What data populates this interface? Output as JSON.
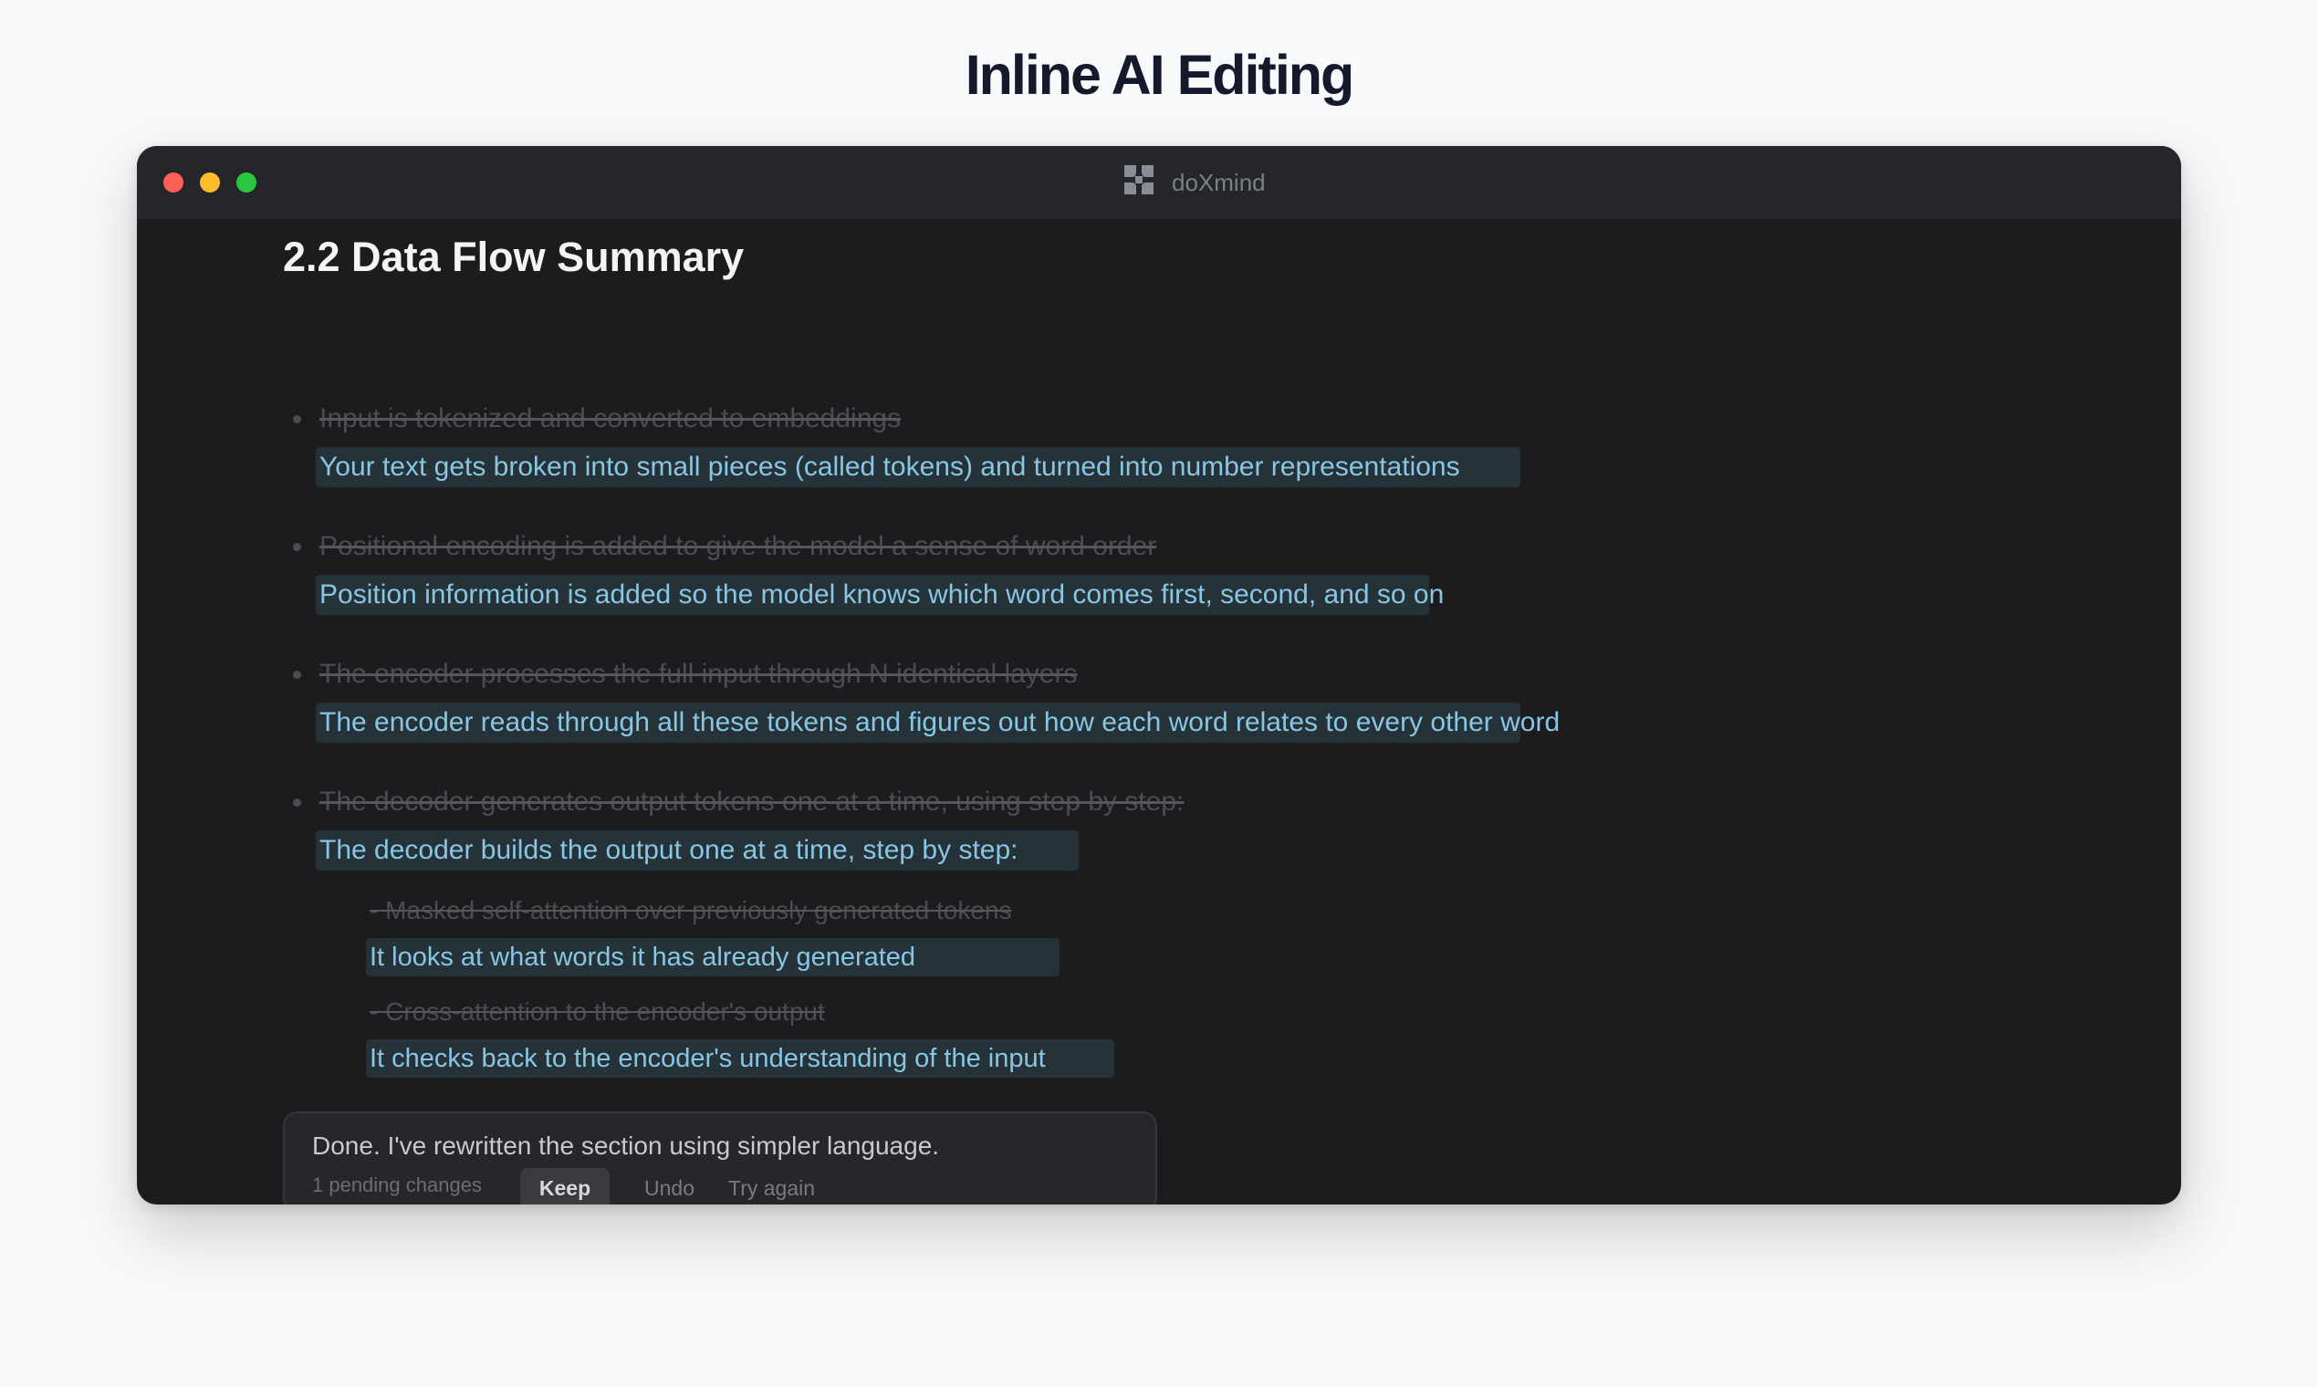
{
  "page": {
    "title": "Inline AI Editing"
  },
  "window": {
    "app_name": "doXmind",
    "app_icon": "doxmind-logo-icon"
  },
  "document": {
    "heading": "2.2 Data Flow Summary",
    "edits": [
      {
        "original": "Input is tokenized and converted to embeddings",
        "rewrite": "Your text gets broken into small pieces (called tokens) and turned into number representations"
      },
      {
        "original": "Positional encoding is added to give the model a sense of word order",
        "rewrite": "Position information is added so the model knows which word comes first, second, and so on"
      },
      {
        "original": "The encoder processes the full input through N identical layers",
        "rewrite": "The encoder reads through all these tokens and figures out how each word relates to every other word"
      },
      {
        "original": "The decoder generates output tokens one at a time, using step by step:",
        "rewrite": "The decoder builds the output one at a time, step by step:",
        "sub_edits": [
          {
            "original": "- Masked self-attention over previously generated tokens",
            "rewrite": "It looks at what words it has already generated"
          },
          {
            "original": "- Cross-attention to the encoder's output",
            "rewrite": "It checks back to the encoder's understanding of the input"
          }
        ]
      }
    ]
  },
  "ai_panel": {
    "message": "Done. I've rewritten the section using simpler language.",
    "pending": "1 pending changes",
    "keep_label": "Keep",
    "undo_label": "Undo",
    "retry_label": "Try again"
  },
  "colors": {
    "accent_text": "#88c6e4",
    "highlight_bg": "#253237",
    "window_bg": "#1c1c1e",
    "strikethrough_text": "#4b4d52"
  }
}
